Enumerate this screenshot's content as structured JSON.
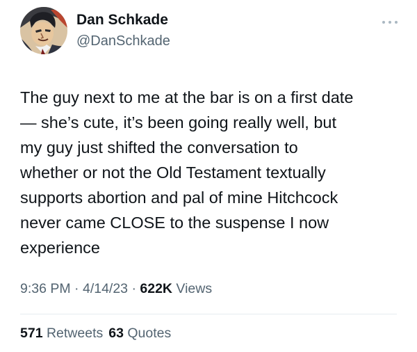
{
  "author": {
    "display_name": "Dan Schkade",
    "handle": "@DanSchkade"
  },
  "tweet": {
    "text": "The guy next to me at the bar is on a first date\n— she’s cute, it’s been going really well, but\nmy guy just shifted the conversation to\nwhether or not the Old Testament textually\nsupports abortion and pal of mine Hitchcock\nnever came CLOSE to the suspense I now\nexperience"
  },
  "meta": {
    "time": "9:36 PM",
    "separator": " · ",
    "date": "4/14/23",
    "views_count": "622K",
    "views_label": " Views"
  },
  "stats": {
    "retweets_count": "571",
    "retweets_label": " Retweets",
    "quotes_count": "63",
    "quotes_label": " Quotes"
  },
  "icons": {
    "avatar": "comic-avatar",
    "more": "more-options-icon"
  },
  "colors": {
    "primary_text": "#0f1419",
    "secondary_text": "#536471",
    "divider": "#e6ecf0"
  }
}
